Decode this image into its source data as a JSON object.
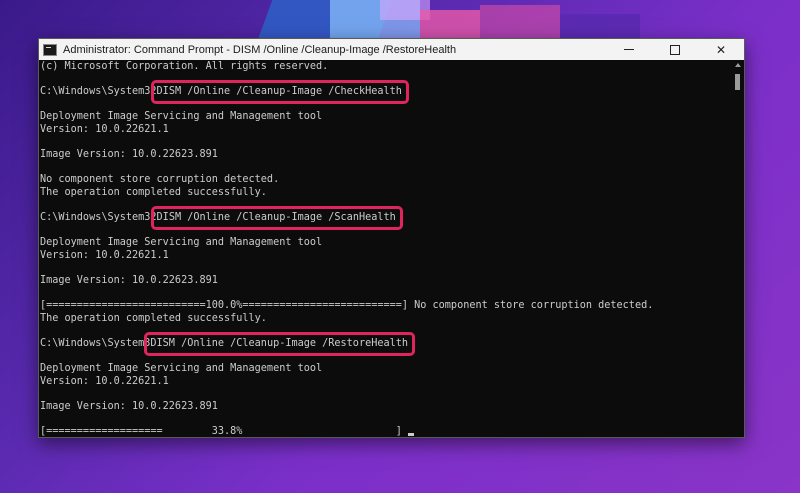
{
  "window": {
    "title": "Administrator: Command Prompt - DISM  /Online /Cleanup-Image /RestoreHealth",
    "controls": {
      "minimize": "",
      "maximize": "",
      "close": "✕"
    }
  },
  "console": {
    "lines": [
      {
        "text": "(c) Microsoft Corporation. All rights reserved."
      },
      {
        "text": ""
      },
      {
        "prompt": "C:\\Windows\\System32",
        "command": "DISM /Online /Cleanup-Image /CheckHealth"
      },
      {
        "text": ""
      },
      {
        "text": "Deployment Image Servicing and Management tool"
      },
      {
        "text": "Version: 10.0.22621.1"
      },
      {
        "text": ""
      },
      {
        "text": "Image Version: 10.0.22623.891"
      },
      {
        "text": ""
      },
      {
        "text": "No component store corruption detected."
      },
      {
        "text": "The operation completed successfully."
      },
      {
        "text": ""
      },
      {
        "prompt": "C:\\Windows\\System32",
        "command": "DISM /Online /Cleanup-Image /ScanHealth"
      },
      {
        "text": ""
      },
      {
        "text": "Deployment Image Servicing and Management tool"
      },
      {
        "text": "Version: 10.0.22621.1"
      },
      {
        "text": ""
      },
      {
        "text": "Image Version: 10.0.22623.891"
      },
      {
        "text": ""
      },
      {
        "text": "[==========================100.0%==========================] No component store corruption detected."
      },
      {
        "text": "The operation completed successfully."
      },
      {
        "text": ""
      },
      {
        "prompt": "C:\\Windows\\System3",
        "command": "DISM /Online /Cleanup-Image /RestoreHealth"
      },
      {
        "text": ""
      },
      {
        "text": "Deployment Image Servicing and Management tool"
      },
      {
        "text": "Version: 10.0.22621.1"
      },
      {
        "text": ""
      },
      {
        "text": "Image Version: 10.0.22623.891"
      },
      {
        "text": ""
      },
      {
        "text": "[===================        33.8%                         ] ",
        "cursor": true
      }
    ]
  },
  "colors": {
    "highlight_border": "#e0245e",
    "console_bg": "#0c0c0c",
    "console_fg": "#cccccc"
  }
}
